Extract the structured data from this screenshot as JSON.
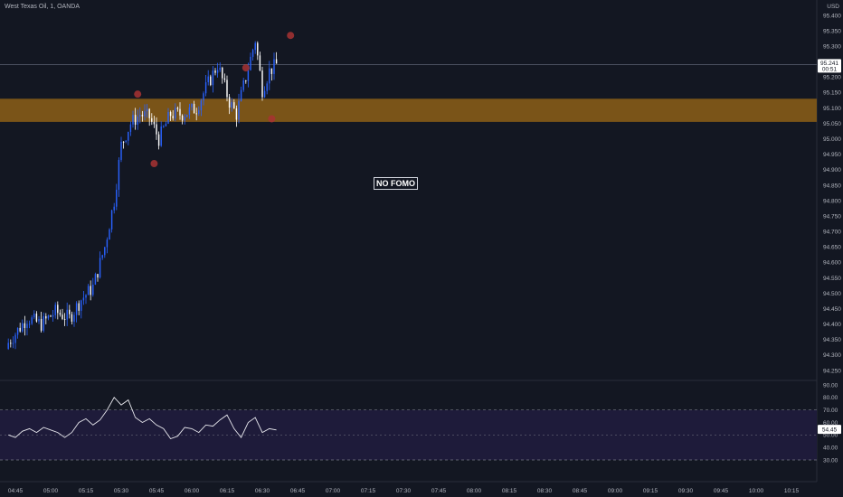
{
  "header": {
    "title": "West Texas Oil, 1, OANDA",
    "currency": "USD"
  },
  "annotation": {
    "text": "NO FOMO"
  },
  "price_tag": {
    "price": "95.241",
    "countdown": "00:51"
  },
  "rsi_tag": {
    "value": "54.45"
  },
  "colors": {
    "background": "#131722",
    "zone": "#7a5418",
    "up": "#2962ff",
    "down": "#ffffff",
    "marker": "#a83232",
    "rsi_line": "#e8e8ee",
    "rsi_band": "#1e1b3a"
  },
  "chart_data": [
    {
      "type": "candlestick",
      "title": "West Texas Oil, 1, OANDA",
      "x_ticks": [
        "04:45",
        "05:00",
        "05:15",
        "05:30",
        "05:45",
        "06:00",
        "06:15",
        "06:30",
        "06:45",
        "07:00",
        "07:15",
        "07:30",
        "07:45",
        "08:00",
        "08:15",
        "08:30",
        "08:45",
        "09:00",
        "09:15",
        "09:30",
        "09:45",
        "10:00",
        "10:15"
      ],
      "y_ticks": [
        "94.250",
        "94.300",
        "94.350",
        "94.400",
        "94.450",
        "94.500",
        "94.550",
        "94.600",
        "94.650",
        "94.700",
        "94.750",
        "94.800",
        "94.850",
        "94.900",
        "94.950",
        "95.000",
        "95.050",
        "95.100",
        "95.150",
        "95.200",
        "95.250",
        "95.300",
        "95.350",
        "95.400"
      ],
      "ylim": [
        94.22,
        95.42
      ],
      "x_start_minute": 282,
      "current_price": 95.241,
      "zone": {
        "low": 95.055,
        "high": 95.13
      },
      "markers": [
        {
          "minute": 337,
          "price": 95.145
        },
        {
          "minute": 344,
          "price": 94.92
        },
        {
          "minute": 383,
          "price": 95.23
        },
        {
          "minute": 394,
          "price": 95.065
        },
        {
          "minute": 402,
          "price": 95.335
        }
      ],
      "waypoints": [
        [
          282,
          94.34
        ],
        [
          290,
          94.42
        ],
        [
          296,
          94.4
        ],
        [
          302,
          94.44
        ],
        [
          308,
          94.42
        ],
        [
          313,
          94.48
        ],
        [
          318,
          94.52
        ],
        [
          323,
          94.65
        ],
        [
          327,
          94.8
        ],
        [
          330,
          94.98
        ],
        [
          334,
          95.05
        ],
        [
          338,
          95.08
        ],
        [
          342,
          95.07
        ],
        [
          346,
          95.0
        ],
        [
          351,
          95.08
        ],
        [
          356,
          95.08
        ],
        [
          362,
          95.1
        ],
        [
          367,
          95.18
        ],
        [
          371,
          95.24
        ],
        [
          376,
          95.12
        ],
        [
          379,
          95.08
        ],
        [
          383,
          95.2
        ],
        [
          387,
          95.32
        ],
        [
          390,
          95.16
        ],
        [
          393,
          95.22
        ],
        [
          396,
          95.24
        ]
      ]
    },
    {
      "type": "line",
      "title": "",
      "y_ticks": [
        "30.00",
        "40.00",
        "50.00",
        "60.00",
        "70.00",
        "80.00",
        "90.00"
      ],
      "ylim": [
        25,
        92
      ],
      "band": [
        30,
        70
      ],
      "midline": 50,
      "last_value": 54.45,
      "x_start_minute": 282,
      "x": [
        282,
        285,
        288,
        291,
        294,
        297,
        300,
        303,
        306,
        309,
        312,
        315,
        318,
        321,
        324,
        327,
        330,
        333,
        336,
        339,
        342,
        345,
        348,
        351,
        354,
        357,
        360,
        363,
        366,
        369,
        372,
        375,
        378,
        381,
        384,
        387,
        390,
        393,
        396
      ],
      "values": [
        50,
        48,
        53,
        55,
        52,
        56,
        54,
        52,
        48,
        52,
        60,
        63,
        58,
        62,
        70,
        80,
        74,
        78,
        64,
        60,
        63,
        58,
        55,
        47,
        49,
        56,
        55,
        52,
        58,
        57,
        62,
        66,
        55,
        48,
        60,
        64,
        52,
        55,
        54
      ]
    }
  ]
}
